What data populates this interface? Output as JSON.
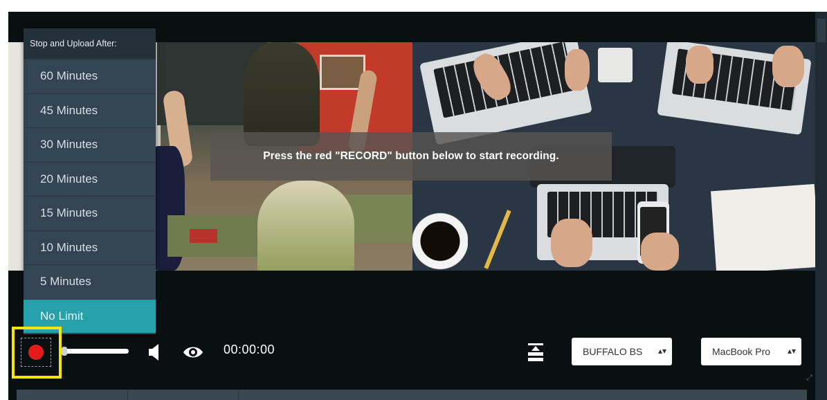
{
  "notice": {
    "text": "Press the red \"RECORD\" button below to start recording."
  },
  "menu": {
    "header": "Stop and Upload After:",
    "items": [
      {
        "label": "60 Minutes",
        "selected": false
      },
      {
        "label": "45 Minutes",
        "selected": false
      },
      {
        "label": "30 Minutes",
        "selected": false
      },
      {
        "label": "20 Minutes",
        "selected": false
      },
      {
        "label": "15 Minutes",
        "selected": false
      },
      {
        "label": "10 Minutes",
        "selected": false
      },
      {
        "label": "5 Minutes",
        "selected": false
      },
      {
        "label": "No Limit",
        "selected": true
      }
    ]
  },
  "controls": {
    "timer": "00:00:00",
    "camera_select": {
      "value": "BUFFALO BS"
    },
    "mic_select": {
      "value": "MacBook Pro"
    },
    "icons": {
      "record": "record-icon",
      "volume": "speaker-icon",
      "preview": "eye-icon",
      "layout": "layout-icon",
      "select_arrow": "sort-arrows-icon"
    }
  },
  "colors": {
    "record": "#e41b1b",
    "highlight": "#f5e60a",
    "menu_bg": "#354452",
    "menu_selected": "#26a0aa",
    "player_bg": "#0a0f12"
  }
}
